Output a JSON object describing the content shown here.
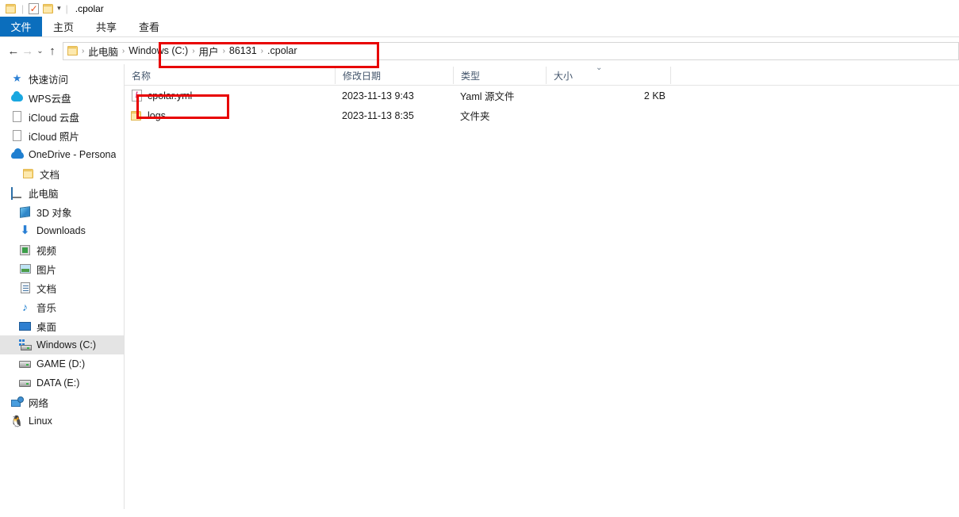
{
  "window": {
    "title": ".cpolar",
    "icons": [
      "folder-icon",
      "checked-document-icon",
      "folder-icon",
      "dropdown-caret-icon"
    ]
  },
  "ribbon": {
    "tabs": [
      {
        "label": "文件",
        "active": true
      },
      {
        "label": "主页",
        "active": false
      },
      {
        "label": "共享",
        "active": false
      },
      {
        "label": "查看",
        "active": false
      }
    ],
    "active_tab_color": "#0b6ebd"
  },
  "address_bar": {
    "back_label": "←",
    "forward_label": "→",
    "history_label": "⌄",
    "up_label": "↑",
    "breadcrumbs": [
      "此电脑",
      "Windows (C:)",
      "用户",
      "86131",
      ".cpolar"
    ],
    "separator": "›"
  },
  "sidebar": {
    "items": [
      {
        "label": "快速访问",
        "icon": "star-icon",
        "indent": 0,
        "selected": false
      },
      {
        "label": "WPS云盘",
        "icon": "wps-cloud-icon",
        "indent": 0,
        "selected": false
      },
      {
        "label": "iCloud 云盘",
        "icon": "icloud-drive-icon",
        "indent": 0,
        "selected": false
      },
      {
        "label": "iCloud 照片",
        "icon": "icloud-photos-icon",
        "indent": 0,
        "selected": false
      },
      {
        "label": "OneDrive - Persona",
        "icon": "onedrive-cloud-icon",
        "indent": 0,
        "selected": false
      },
      {
        "label": "文档",
        "icon": "folder-icon",
        "indent": 1,
        "selected": false
      },
      {
        "label": "此电脑",
        "icon": "this-pc-icon",
        "indent": 0,
        "selected": false
      },
      {
        "label": "3D 对象",
        "icon": "3d-objects-icon",
        "indent": 1,
        "selected": false
      },
      {
        "label": "Downloads",
        "icon": "downloads-icon",
        "indent": 1,
        "selected": false
      },
      {
        "label": "视频",
        "icon": "videos-icon",
        "indent": 1,
        "selected": false
      },
      {
        "label": "图片",
        "icon": "pictures-icon",
        "indent": 1,
        "selected": false
      },
      {
        "label": "文档",
        "icon": "documents-icon",
        "indent": 1,
        "selected": false
      },
      {
        "label": "音乐",
        "icon": "music-icon",
        "indent": 1,
        "selected": false
      },
      {
        "label": "桌面",
        "icon": "desktop-icon",
        "indent": 1,
        "selected": false
      },
      {
        "label": "Windows (C:)",
        "icon": "windows-drive-icon",
        "indent": 1,
        "selected": true
      },
      {
        "label": "GAME (D:)",
        "icon": "drive-icon",
        "indent": 1,
        "selected": false
      },
      {
        "label": "DATA (E:)",
        "icon": "drive-icon",
        "indent": 1,
        "selected": false
      },
      {
        "label": "网络",
        "icon": "network-icon",
        "indent": 0,
        "selected": false
      },
      {
        "label": "Linux",
        "icon": "linux-icon",
        "indent": 0,
        "selected": false
      }
    ],
    "selection_color": "#e4e4e4"
  },
  "file_list": {
    "columns": [
      {
        "label": "名称",
        "sorted": false
      },
      {
        "label": "修改日期",
        "sorted": false
      },
      {
        "label": "类型",
        "sorted": false
      },
      {
        "label": "大小",
        "sorted": true
      }
    ],
    "sort_indicator": "⌄",
    "rows": [
      {
        "name": "cpolar.yml",
        "icon": "yaml-file-icon",
        "modified": "2023-11-13 9:43",
        "type": "Yaml 源文件",
        "size": "2 KB"
      },
      {
        "name": "logs",
        "icon": "folder-icon",
        "modified": "2023-11-13 8:35",
        "type": "文件夹",
        "size": ""
      }
    ]
  },
  "annotations": {
    "color": "#e80000",
    "boxes": [
      {
        "name": "path-highlight",
        "target": "breadcrumb-path"
      },
      {
        "name": "file-highlight",
        "target": "cpolar-yml-row"
      }
    ]
  }
}
